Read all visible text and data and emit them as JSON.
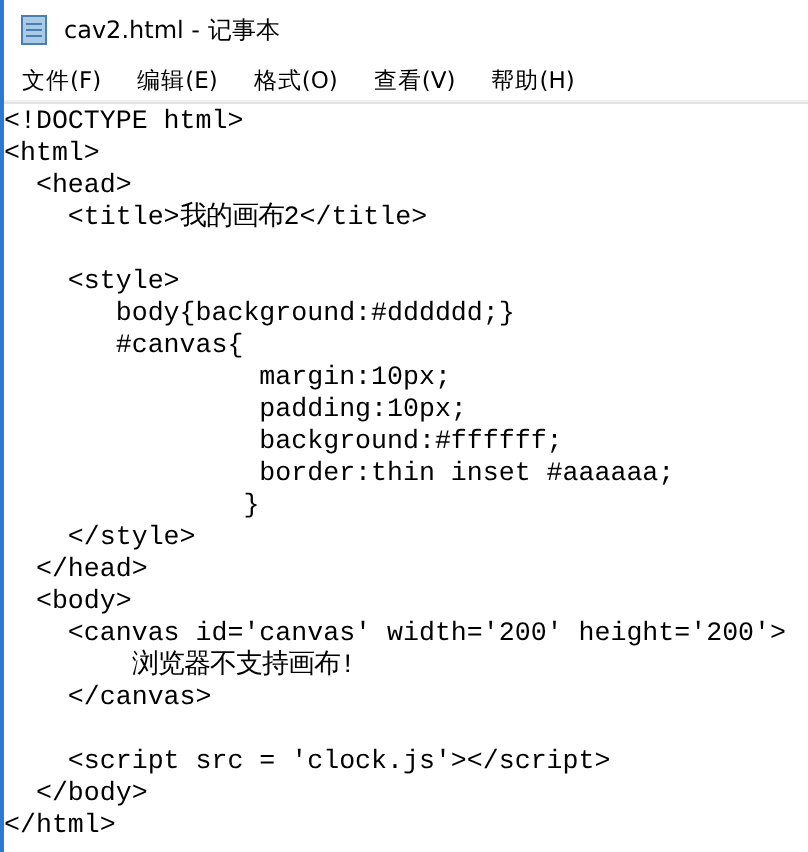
{
  "window": {
    "title": "cav2.html - 记事本"
  },
  "menu": [
    "文件(F)",
    "编辑(E)",
    "格式(O)",
    "查看(V)",
    "帮助(H)"
  ],
  "editor": {
    "blocks": [
      [
        "<!DOCTYPE html>",
        "<html>",
        "  <head>",
        "    <title>我的画布2</title>"
      ],
      [
        "    <style>",
        "       body{background:#dddddd;}",
        "       #canvas{",
        "                margin:10px;",
        "                padding:10px;",
        "                background:#ffffff;",
        "                border:thin inset #aaaaaa;",
        "               }",
        "    </style>",
        "  </head>",
        "  <body>",
        "    <canvas id='canvas' width='200' height='200'>",
        "        浏览器不支持画布!",
        "    </canvas>"
      ],
      [
        "    <script src = 'clock.js'></script>",
        "  </body>",
        "</html>"
      ]
    ]
  }
}
